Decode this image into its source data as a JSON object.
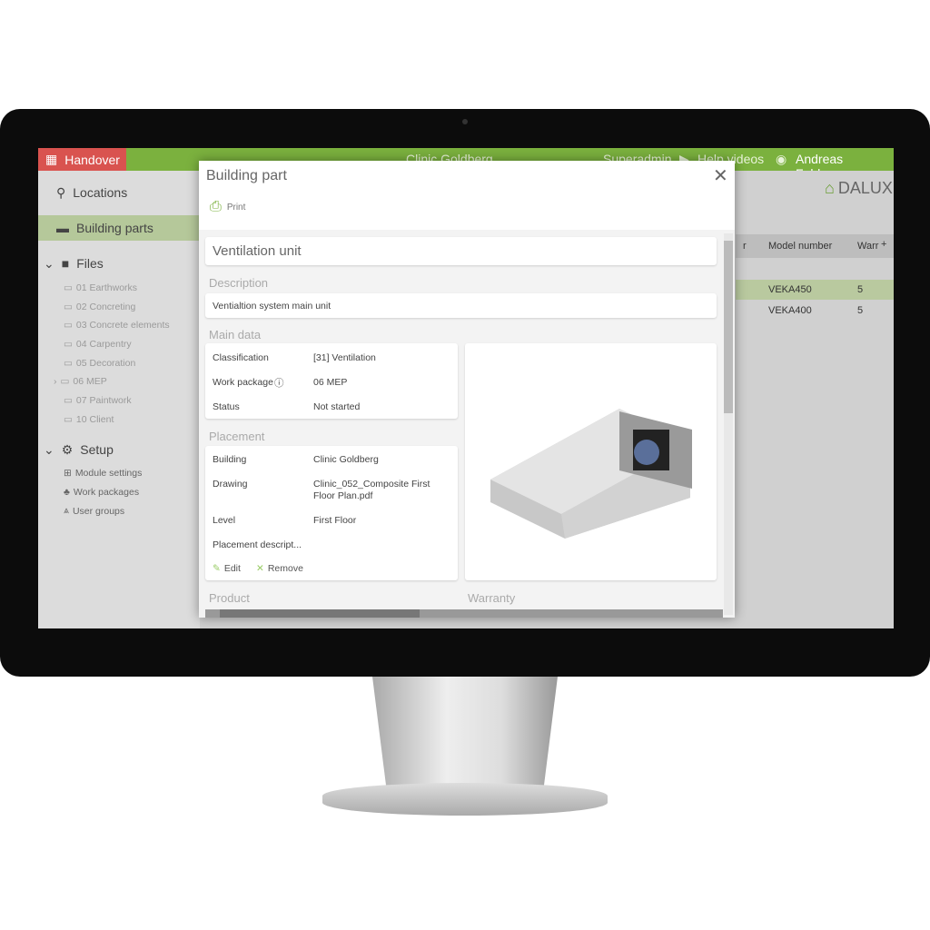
{
  "topbar": {
    "app": "Handover",
    "project": "Clinic Goldberg",
    "role": "Superadmin",
    "help": "Help videos",
    "user": "Andreas Foldager",
    "logo": "DALUX",
    "accent": "#7bb13e",
    "app_color": "#d9534f"
  },
  "sidebar": {
    "locations": "Locations",
    "building_parts": "Building parts",
    "files": "Files",
    "folders": [
      "01 Earthworks",
      "02 Concreting",
      "03 Concrete elements",
      "04 Carpentry",
      "05 Decoration",
      "06 MEP",
      "07 Paintwork",
      "10 Client"
    ],
    "setup": "Setup",
    "setup_items": [
      "Module settings",
      "Work packages",
      "User groups"
    ]
  },
  "table": {
    "headers": [
      "r",
      "Model number",
      "Warr"
    ],
    "rows": [
      [
        "VEKA450",
        "5"
      ],
      [
        "VEKA400",
        "5"
      ]
    ]
  },
  "modal": {
    "title": "Building part",
    "print": "Print",
    "name": "Ventilation unit",
    "description_label": "Description",
    "description": "Ventialtion system main unit",
    "main_data_label": "Main data",
    "main_data": [
      {
        "label": "Classification",
        "value": "[31] Ventilation"
      },
      {
        "label": "Work package",
        "value": "06 MEP"
      },
      {
        "label": "Status",
        "value": "Not started"
      }
    ],
    "placement_label": "Placement",
    "placement": [
      {
        "label": "Building",
        "value": "Clinic Goldberg"
      },
      {
        "label": "Drawing",
        "value": "Clinic_052_Composite First Floor Plan.pdf"
      },
      {
        "label": "Level",
        "value": "First Floor"
      },
      {
        "label": "Placement descript...",
        "value": ""
      }
    ],
    "edit": "Edit",
    "remove": "Remove",
    "product_label": "Product",
    "warranty_label": "Warranty"
  }
}
